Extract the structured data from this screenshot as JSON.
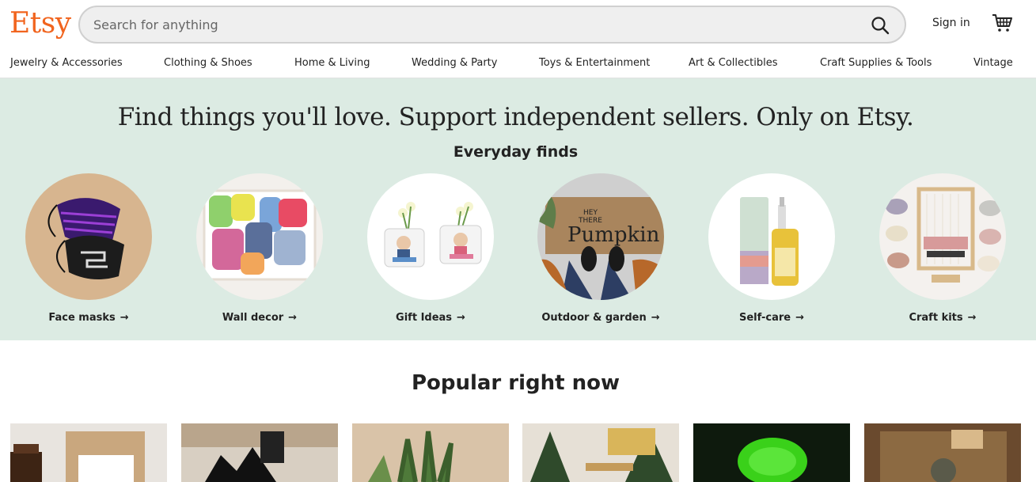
{
  "header": {
    "logo": "Etsy",
    "search_placeholder": "Search for anything",
    "sign_in": "Sign in",
    "icons": {
      "search": "search-icon",
      "cart": "cart-icon"
    },
    "brand_color": "#F1641E"
  },
  "categories": [
    "Jewelry & Accessories",
    "Clothing & Shoes",
    "Home & Living",
    "Wedding & Party",
    "Toys & Entertainment",
    "Art & Collectibles",
    "Craft Supplies & Tools",
    "Vintage"
  ],
  "hero": {
    "title": "Find things you'll love. Support independent sellers. Only on Etsy.",
    "subtitle": "Everyday finds",
    "background": "#dcebe3",
    "finds": [
      {
        "label": "Face masks",
        "arrow": "→"
      },
      {
        "label": "Wall decor",
        "arrow": "→"
      },
      {
        "label": "Gift Ideas",
        "arrow": "→"
      },
      {
        "label": "Outdoor & garden",
        "arrow": "→"
      },
      {
        "label": "Self-care",
        "arrow": "→"
      },
      {
        "label": "Craft kits",
        "arrow": "→"
      }
    ]
  },
  "popular": {
    "title": "Popular right now"
  }
}
